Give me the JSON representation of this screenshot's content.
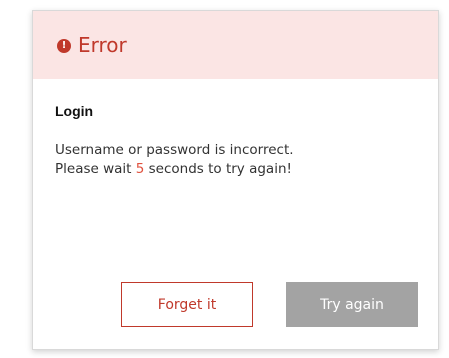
{
  "dialog": {
    "title": "Error",
    "icon": "error-icon",
    "section_title": "Login",
    "message_line1": "Username or password is incorrect.",
    "message_line2_prefix": "Please wait ",
    "countdown_seconds": "5",
    "message_line2_suffix": " seconds to try again!",
    "buttons": {
      "forget_label": "Forget it",
      "retry_label": "Try again"
    }
  },
  "colors": {
    "header_background": "#fbe5e4",
    "error_red": "#c0392b",
    "countdown_accent": "#e0523f",
    "disabled_button": "#a3a3a3"
  }
}
